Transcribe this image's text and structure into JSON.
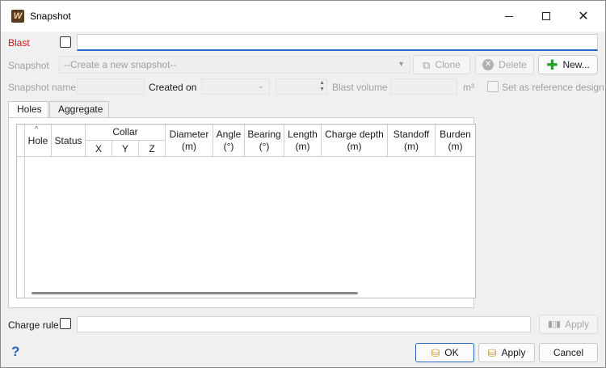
{
  "window": {
    "title": "Snapshot",
    "minimize": "—",
    "maximize": "☐",
    "close": "✕"
  },
  "blast": {
    "label": "Blast",
    "value": ""
  },
  "snapshot": {
    "label": "Snapshot",
    "placeholder": "--Create a new snapshot--",
    "clone_label": "Clone",
    "delete_label": "Delete",
    "new_label": "New..."
  },
  "meta": {
    "snapshot_name_label": "Snapshot name",
    "created_on_label": "Created on",
    "blast_volume_label": "Blast volume",
    "volume_unit": "m³",
    "reference_label": "Set as reference design"
  },
  "tabs": [
    {
      "label": "Holes",
      "active": true
    },
    {
      "label": "Aggregate",
      "active": false
    }
  ],
  "columns": {
    "hole": "Hole",
    "status": "Status",
    "collar": "Collar",
    "x": "X",
    "y": "Y",
    "z": "Z",
    "diameter": [
      "Diameter",
      "(m)"
    ],
    "angle": [
      "Angle",
      "(°)"
    ],
    "bearing": [
      "Bearing",
      "(°)"
    ],
    "length": [
      "Length",
      "(m)"
    ],
    "charge_depth": [
      "Charge depth",
      "(m)"
    ],
    "standoff": [
      "Standoff",
      "(m)"
    ],
    "burden": [
      "Burden",
      "(m)"
    ]
  },
  "charge_rule": {
    "label": "Charge rule",
    "value": "",
    "apply_label": "Apply"
  },
  "footer": {
    "ok_label": "OK",
    "apply_label": "Apply",
    "cancel_label": "Cancel"
  },
  "colors": {
    "accent": "#2a64c5",
    "blast_label": "#d01818",
    "new_icon": "#2e9e2e"
  },
  "icons": {
    "app": "snapshot-app-icon",
    "clone": "clone-icon",
    "delete": "delete-icon",
    "new": "plus-icon",
    "apply_rule": "apply-rule-icon",
    "ok": "database-icon",
    "apply": "database-icon",
    "help": "help-icon"
  }
}
